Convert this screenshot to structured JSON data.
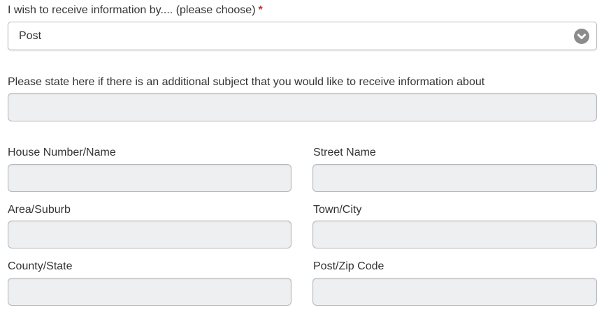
{
  "contact_method": {
    "label": "I wish to receive information by.... (please choose)",
    "required_mark": "*",
    "selected": "Post"
  },
  "additional_subject": {
    "label": "Please state here if there is an additional subject that you would like to receive information about",
    "value": ""
  },
  "address": {
    "house": {
      "label": "House Number/Name",
      "value": ""
    },
    "street": {
      "label": "Street Name",
      "value": ""
    },
    "area": {
      "label": "Area/Suburb",
      "value": ""
    },
    "town": {
      "label": "Town/City",
      "value": ""
    },
    "county": {
      "label": "County/State",
      "value": ""
    },
    "postcode": {
      "label": "Post/Zip Code",
      "value": ""
    }
  },
  "colors": {
    "required": "#c0392b",
    "field_bg": "#eeeff1",
    "field_border": "#b4b8bd",
    "text": "#333333"
  }
}
